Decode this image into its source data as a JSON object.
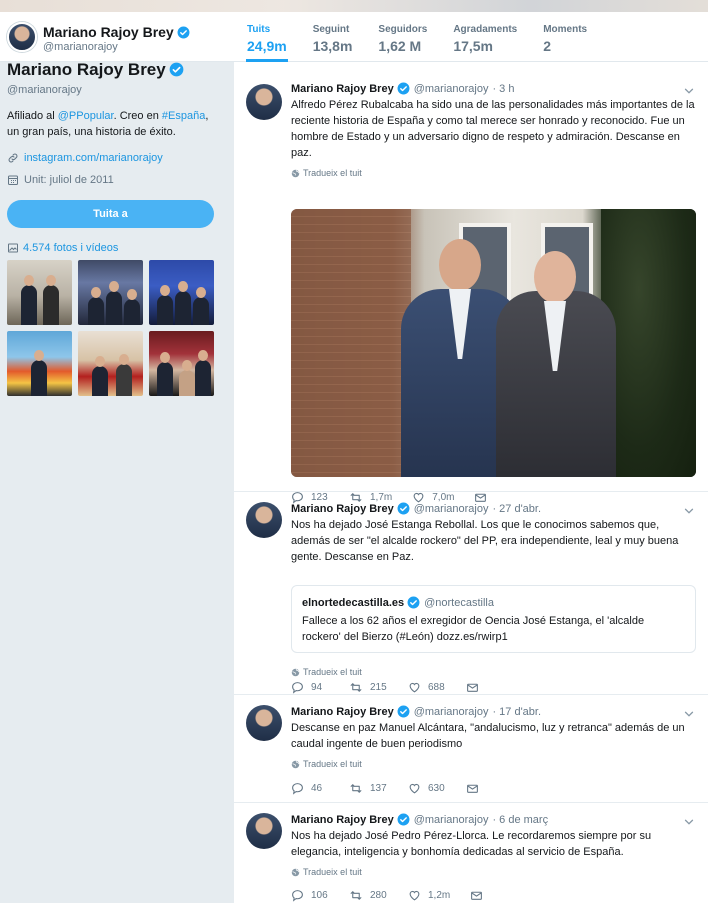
{
  "header": {
    "name": "Mariano Rajoy Brey",
    "handle": "@marianorajoy",
    "nav": [
      {
        "label": "Tuits",
        "value": "24,9m"
      },
      {
        "label": "Seguint",
        "value": "13,8m"
      },
      {
        "label": "Seguidors",
        "value": "1,62 M"
      },
      {
        "label": "Agradaments",
        "value": "17,5m"
      },
      {
        "label": "Moments",
        "value": "2"
      }
    ]
  },
  "profile": {
    "name": "Mariano Rajoy Brey",
    "handle": "@marianorajoy",
    "bio_prefix": "Afiliado al ",
    "bio_link1": "@PPopular",
    "bio_mid": ". Creo en ",
    "bio_link2": "#España",
    "bio_suffix": ", un gran país, una historia de éxito.",
    "website": "instagram.com/marianorajoy",
    "joined": "Unit: juliol de 2011",
    "tweet_button": "Tuita a",
    "photos_label": "4.574 fotos i vídeos"
  },
  "tweets": [
    {
      "author": "Mariano Rajoy Brey",
      "handle": "@marianorajoy",
      "time": "· 3 h",
      "text": "Alfredo Pérez Rubalcaba ha sido una de las personalidades más importantes de la reciente historia de España y como tal merece ser honrado y reconocido. Fue un hombre de Estado y un adversario digno de respeto y admiración. Descanse en paz.",
      "translate": "Tradueix el tuit",
      "replies": "123",
      "retweets": "1,7m",
      "likes": "7,0m"
    },
    {
      "author": "Mariano Rajoy Brey",
      "handle": "@marianorajoy",
      "time": "· 27 d'abr.",
      "text": "Nos ha dejado José Estanga Rebollal. Los que le conocimos sabemos que, además de ser \"el alcalde rockero\" del PP, era independiente, leal y muy buena gente. Descanse en Paz.",
      "quote_author": "elnortedecastilla.es",
      "quote_handle": "@nortecastilla",
      "quote_text": "Fallece a los 62 años el exregidor de Oencia José Estanga, el 'alcalde rockero' del Bierzo (#León) dozz.es/rwirp1",
      "translate": "Tradueix el tuit",
      "replies": "94",
      "retweets": "215",
      "likes": "688"
    },
    {
      "author": "Mariano Rajoy Brey",
      "handle": "@marianorajoy",
      "time": "· 17 d'abr.",
      "text": "Descanse en paz Manuel Alcántara, \"andalucismo, luz y retranca\" además de un caudal ingente de buen periodismo",
      "translate": "Tradueix el tuit",
      "replies": "46",
      "retweets": "137",
      "likes": "630"
    },
    {
      "author": "Mariano Rajoy Brey",
      "handle": "@marianorajoy",
      "time": "· 6 de març",
      "text": "Nos ha dejado José Pedro Pérez-Llorca. Le recordaremos siempre por su elegancia, inteligencia y bonhomía dedicadas al servicio de España.",
      "translate": "Tradueix el tuit",
      "replies": "106",
      "retweets": "280",
      "likes": "1,2m"
    }
  ],
  "colors": {
    "accent": "#1da1f2",
    "button": "#4ab3f4",
    "muted": "#657786"
  }
}
